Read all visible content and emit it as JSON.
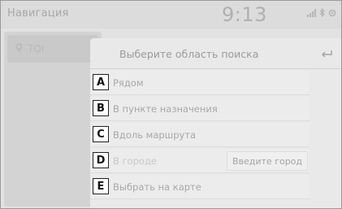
{
  "status_bar": {
    "app_title": "Навигация",
    "clock": "9:13",
    "icons": [
      "signal-icon",
      "bluetooth-icon",
      "settings-icon"
    ]
  },
  "side_panel": {
    "poi_label": "TOI",
    "poi_icon": "map-pin-icon"
  },
  "main_panel": {
    "title": "Выберите область поиска",
    "back_icon": "back-arrow-icon",
    "options": [
      {
        "callout": "A",
        "label": "Рядом",
        "enabled": true
      },
      {
        "callout": "B",
        "label": "В пункте назначения",
        "enabled": true
      },
      {
        "callout": "C",
        "label": "Вдоль маршрута",
        "enabled": true
      },
      {
        "callout": "D",
        "label": "В городе",
        "enabled": false,
        "city_button": "Введите город"
      },
      {
        "callout": "E",
        "label": "Выбрать на карте",
        "enabled": true
      }
    ]
  }
}
